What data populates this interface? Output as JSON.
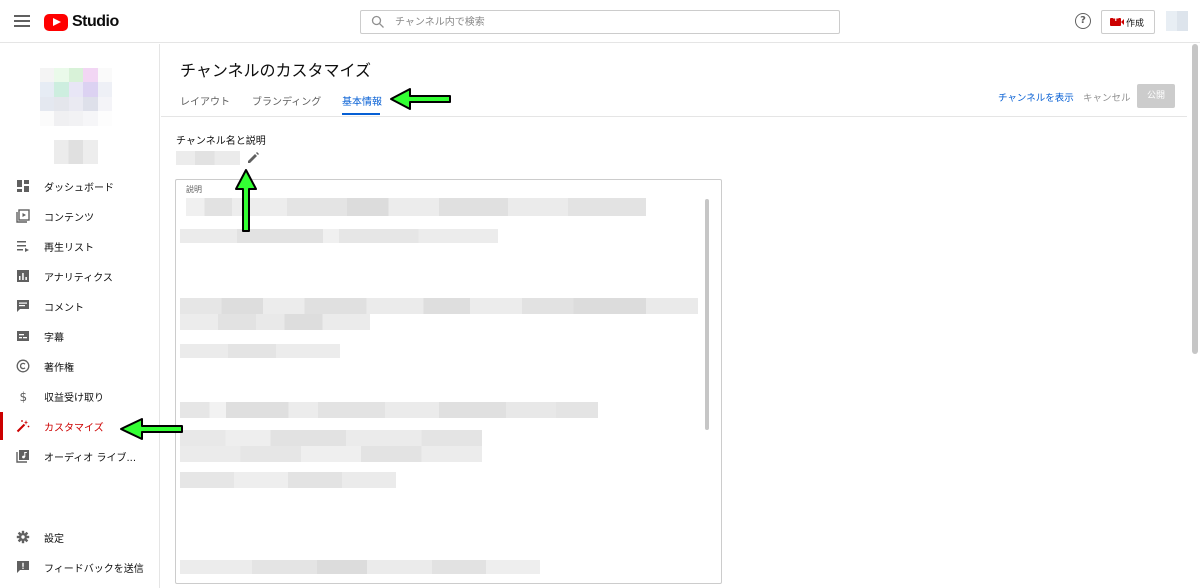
{
  "header": {
    "app_name": "Studio",
    "search_placeholder": "チャンネル内で検索",
    "help_label": "?",
    "create_label": "作成"
  },
  "sidebar": {
    "items": [
      {
        "label": "ダッシュボード",
        "icon": "dashboard-icon"
      },
      {
        "label": "コンテンツ",
        "icon": "content-icon"
      },
      {
        "label": "再生リスト",
        "icon": "playlist-icon"
      },
      {
        "label": "アナリティクス",
        "icon": "analytics-icon"
      },
      {
        "label": "コメント",
        "icon": "comment-icon"
      },
      {
        "label": "字幕",
        "icon": "subtitles-icon"
      },
      {
        "label": "著作権",
        "icon": "copyright-icon"
      },
      {
        "label": "収益受け取り",
        "icon": "dollar-icon"
      },
      {
        "label": "カスタマイズ",
        "icon": "magic-wand-icon",
        "active": true
      },
      {
        "label": "オーディオ ライブ...",
        "icon": "audio-library-icon"
      }
    ],
    "bottom_items": [
      {
        "label": "設定",
        "icon": "gear-icon"
      },
      {
        "label": "フィードバックを送信",
        "icon": "feedback-icon"
      }
    ]
  },
  "main": {
    "title": "チャンネルのカスタマイズ",
    "tabs": [
      {
        "label": "レイアウト"
      },
      {
        "label": "ブランディング"
      },
      {
        "label": "基本情報",
        "active": true
      }
    ],
    "actions": {
      "view_channel": "チャンネルを表示",
      "cancel": "キャンセル",
      "publish": "公開"
    },
    "section_label": "チャンネル名と説明",
    "description_label": "説明"
  },
  "colors": {
    "accent_blue": "#065fd4",
    "active_red": "#cc0000",
    "annotation_arrow": "#33ff33"
  }
}
